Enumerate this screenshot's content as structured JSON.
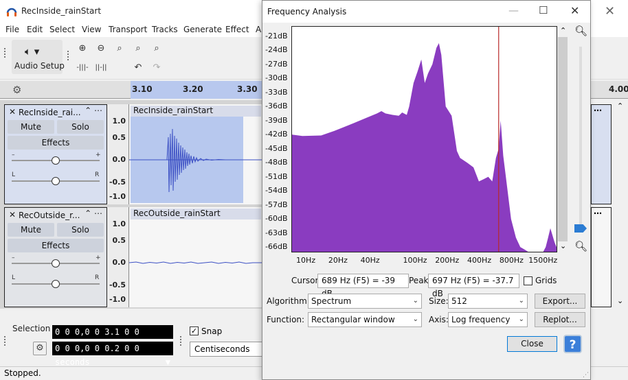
{
  "window": {
    "title": "RecInside_rainStart",
    "close_glyph": "✕"
  },
  "menu": [
    "File",
    "Edit",
    "Select",
    "View",
    "Transport",
    "Tracks",
    "Generate",
    "Effect",
    "A"
  ],
  "toolbar": {
    "audio_setup": "Audio Setup"
  },
  "ruler": {
    "ticks": [
      "3.10",
      "3.20",
      "3.30",
      "4.00"
    ]
  },
  "tracks": [
    {
      "name": "RecInside_rai...",
      "clip": "RecInside_rainStart",
      "mute": "Mute",
      "solo": "Solo",
      "effects": "Effects",
      "scale": [
        "1.0",
        "0.5",
        "0.0",
        "-0.5",
        "-1.0"
      ],
      "gain_minus": "–",
      "gain_plus": "+",
      "pan_l": "L",
      "pan_r": "R"
    },
    {
      "name": "RecOutside_r...",
      "clip": "RecOutside_rainStart",
      "mute": "Mute",
      "solo": "Solo",
      "effects": "Effects",
      "scale": [
        "1.0",
        "0.5",
        "0.0",
        "-0.5",
        "-1.0"
      ],
      "gain_minus": "–",
      "gain_plus": "+",
      "pan_l": "L",
      "pan_r": "R"
    }
  ],
  "bottom": {
    "selection_label": "Selection",
    "start": "0 0 0,0 0 3.1 0 0 seconds",
    "length": "0 0 0,0 0 0.2 0 0 seconds",
    "snap_label": "Snap",
    "snap_checked": true,
    "snap_unit": "Centiseconds"
  },
  "status": "Stopped.",
  "dialog": {
    "title": "Frequency Analysis",
    "cursor_label": "Cursor:",
    "cursor_value": "689 Hz (F5) = -39 dB",
    "peak_label": "Peak:",
    "peak_value": "697 Hz (F5) = -37.7 dB",
    "grids_label": "Grids",
    "grids_checked": false,
    "algorithm_label": "Algorithm:",
    "algorithm": "Spectrum",
    "size_label": "Size:",
    "size": "512",
    "export": "Export...",
    "function_label": "Function:",
    "function": "Rectangular window",
    "axis_label": "Axis:",
    "axis": "Log frequency",
    "replot": "Replot...",
    "close": "Close",
    "help": "?"
  },
  "chart_data": {
    "type": "area",
    "x_scale": "log",
    "xlim": [
      8,
      2400
    ],
    "ylim": [
      -67,
      -19
    ],
    "y_ticks": [
      "-21dB",
      "-24dB",
      "-27dB",
      "-30dB",
      "-33dB",
      "-36dB",
      "-39dB",
      "-42dB",
      "-45dB",
      "-48dB",
      "-51dB",
      "-54dB",
      "-57dB",
      "-60dB",
      "-63dB",
      "-66dB"
    ],
    "x_ticks": [
      "10Hz",
      "20Hz",
      "40Hz",
      "100Hz",
      "200Hz",
      "400Hz",
      "800Hz",
      "1500Hz"
    ],
    "cursor_hz": 689,
    "fill_color": "#8a3cc0",
    "cursor_color": "#b82a2a",
    "series": [
      {
        "x": [
          8,
          10,
          15,
          20,
          30,
          40,
          50,
          55,
          60,
          70,
          80,
          86,
          95,
          100,
          110,
          120,
          130,
          140,
          150,
          165,
          180,
          190,
          200,
          220,
          250,
          280,
          300,
          350,
          400,
          450,
          500,
          550,
          600,
          650,
          689,
          720,
          760,
          800,
          900,
          1000,
          1100,
          1200,
          1300,
          1400,
          1500,
          1600,
          1700,
          1800,
          1900,
          2000,
          2100,
          2200,
          2300,
          2400
        ],
        "values": [
          -42,
          -42.3,
          -42.2,
          -41.2,
          -39.6,
          -38.4,
          -37.5,
          -37.0,
          -37.5,
          -37.8,
          -38.0,
          -37.3,
          -37.8,
          -36.0,
          -31.0,
          -28.5,
          -26.0,
          -31.0,
          -29.0,
          -27.0,
          -23.5,
          -22.5,
          -25.0,
          -36.0,
          -38.0,
          -45.5,
          -47.0,
          -48.0,
          -49.0,
          -52.0,
          -51.5,
          -51.0,
          -52.0,
          -47.0,
          -45.0,
          -39.0,
          -46.5,
          -50.5,
          -60.0,
          -64.0,
          -66.0,
          -66.5,
          -67.0,
          -67.0,
          -67.0,
          -67.0,
          -67.0,
          -67.0,
          -66.0,
          -64.0,
          -62.0,
          -63.5,
          -65.0,
          -66.0
        ]
      }
    ]
  }
}
